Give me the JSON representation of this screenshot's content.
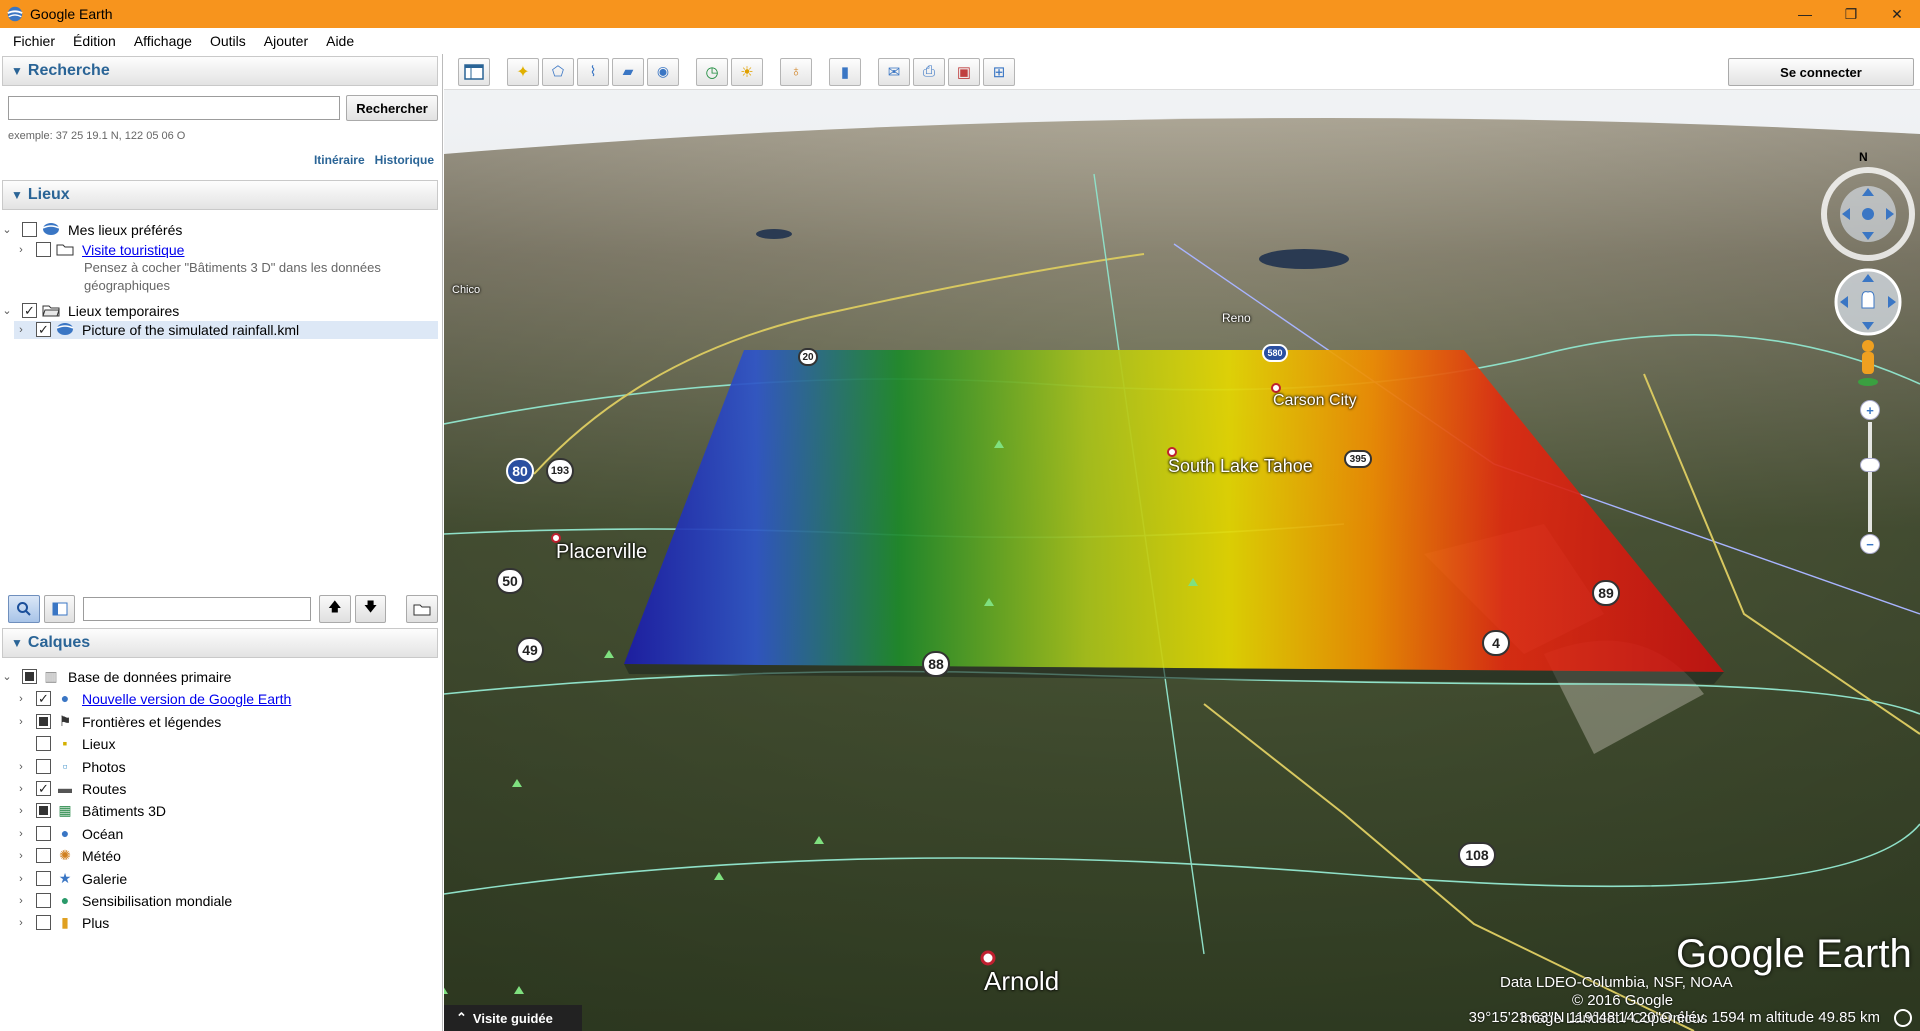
{
  "window": {
    "title": "Google Earth",
    "minimize": "—",
    "maximize": "❐",
    "close": "✕"
  },
  "menu": [
    "Fichier",
    "Édition",
    "Affichage",
    "Outils",
    "Ajouter",
    "Aide"
  ],
  "search": {
    "header": "Recherche",
    "button": "Rechercher",
    "input_value": "",
    "example": "exemple: 37 25 19.1 N, 122 05 06 O",
    "link_itinerary": "Itinéraire",
    "link_history": "Historique"
  },
  "places": {
    "header": "Lieux",
    "favorites": "Mes lieux préférés",
    "tour_link": "Visite touristique",
    "tour_note": "Pensez à cocher \"Bâtiments 3 D\" dans les données géographiques",
    "temp": "Lieux temporaires",
    "kml_item": "Picture of the simulated rainfall.kml"
  },
  "layers": {
    "header": "Calques",
    "items": [
      {
        "label": "Base de données primaire",
        "checked": "partial",
        "link": false,
        "indent": 0
      },
      {
        "label": "Nouvelle version de Google Earth",
        "checked": "yes",
        "link": true,
        "indent": 1
      },
      {
        "label": "Frontières et légendes",
        "checked": "partial",
        "link": false,
        "indent": 1
      },
      {
        "label": "Lieux",
        "checked": "no",
        "link": false,
        "indent": 1
      },
      {
        "label": "Photos",
        "checked": "no",
        "link": false,
        "indent": 1
      },
      {
        "label": "Routes",
        "checked": "yes",
        "link": false,
        "indent": 1
      },
      {
        "label": "Bâtiments 3D",
        "checked": "partial",
        "link": false,
        "indent": 1
      },
      {
        "label": "Océan",
        "checked": "no",
        "link": false,
        "indent": 1
      },
      {
        "label": "Météo",
        "checked": "no",
        "link": false,
        "indent": 1
      },
      {
        "label": "Galerie",
        "checked": "no",
        "link": false,
        "indent": 1
      },
      {
        "label": "Sensibilisation mondiale",
        "checked": "no",
        "link": false,
        "indent": 1
      },
      {
        "label": "Plus",
        "checked": "no",
        "link": false,
        "indent": 1
      }
    ]
  },
  "toolbar": {
    "signin": "Se connecter"
  },
  "map": {
    "compass_n": "N",
    "labels": {
      "placerville": "Placerville",
      "south_lake_tahoe": "South Lake Tahoe",
      "carson_city": "Carson City",
      "arnold": "Arnold",
      "reno": "Reno",
      "chico": "Chico"
    },
    "shields": {
      "i80": "80",
      "r193": "193",
      "r50": "50",
      "r49": "49",
      "r88": "88",
      "r89": "89",
      "r4": "4",
      "r108": "108",
      "r20": "20",
      "r395": "395",
      "r580": "580"
    },
    "attribution": [
      "Data LDEO-Columbia, NSF, NOAA",
      "© 2016 Google",
      "Image Landsat / Copernicus"
    ],
    "logo": "Google Earth"
  },
  "status": {
    "tour": "Visite guidée",
    "coords": "39°15'23.63\"N  119°48'14.20\"O  élév. 1594 m      altitude  49.85 km"
  },
  "colors": {
    "titlebar": "#f7941d",
    "panel_header_text": "#2a6496",
    "rainfall_low": "#1a1aa8",
    "rainfall_mid": "#e6d800",
    "rainfall_high": "#d01010"
  }
}
